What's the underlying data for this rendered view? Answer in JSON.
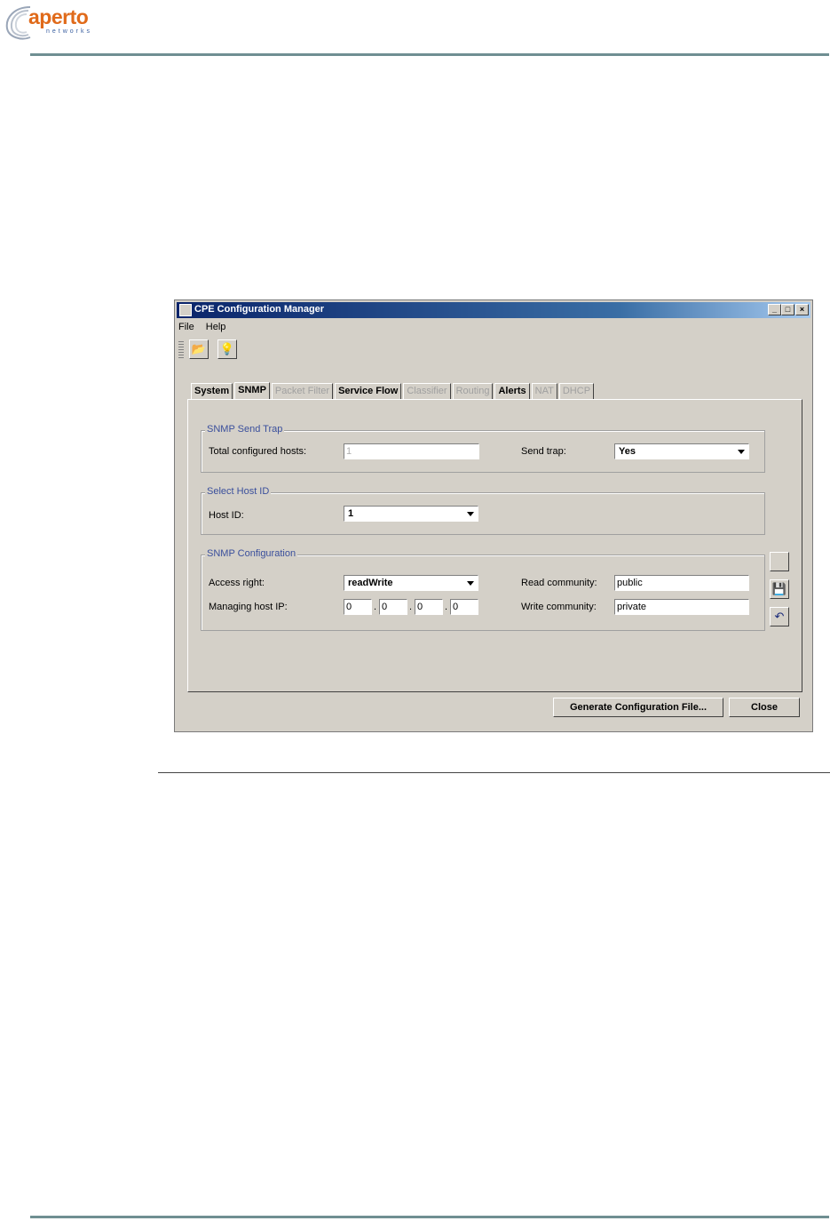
{
  "brand": {
    "name": "aperto",
    "sub": "networks",
    "color": "#e06a1a"
  },
  "window": {
    "title": "CPE Configuration Manager",
    "controls": {
      "minimize": "_",
      "maximize": "□",
      "close": "×"
    }
  },
  "menu": {
    "file": "File",
    "help": "Help"
  },
  "toolbar": {
    "open_icon": "folder-open-icon",
    "help_icon": "lightbulb-help-icon"
  },
  "tabs": [
    {
      "label": "System",
      "state": "enabled"
    },
    {
      "label": "SNMP",
      "state": "active"
    },
    {
      "label": "Packet Filter",
      "state": "disabled"
    },
    {
      "label": "Service Flow",
      "state": "enabled"
    },
    {
      "label": "Classifier",
      "state": "disabled"
    },
    {
      "label": "Routing",
      "state": "disabled"
    },
    {
      "label": "Alerts",
      "state": "enabled"
    },
    {
      "label": "NAT",
      "state": "disabled"
    },
    {
      "label": "DHCP",
      "state": "disabled"
    }
  ],
  "snmp_send_trap": {
    "legend": "SNMP Send Trap",
    "total_hosts_label": "Total configured hosts:",
    "total_hosts_value": "1",
    "send_trap_label": "Send trap:",
    "send_trap_value": "Yes"
  },
  "select_host": {
    "legend": "Select Host ID",
    "host_id_label": "Host ID:",
    "host_id_value": "1"
  },
  "snmp_config": {
    "legend": "SNMP Configuration",
    "access_right_label": "Access right:",
    "access_right_value": "readWrite",
    "managing_ip_label": "Managing host IP:",
    "ip": [
      "0",
      "0",
      "0",
      "0"
    ],
    "read_community_label": "Read community:",
    "read_community_value": "public",
    "write_community_label": "Write community:",
    "write_community_value": "private"
  },
  "side_buttons": {
    "save_icon": "floppy-save-icon",
    "undo_icon": "undo-icon"
  },
  "buttons": {
    "generate": "Generate Configuration File...",
    "close": "Close"
  },
  "colors": {
    "title_start": "#0a246a",
    "legend": "#3a4f9c",
    "rule": "#6f8f92"
  }
}
